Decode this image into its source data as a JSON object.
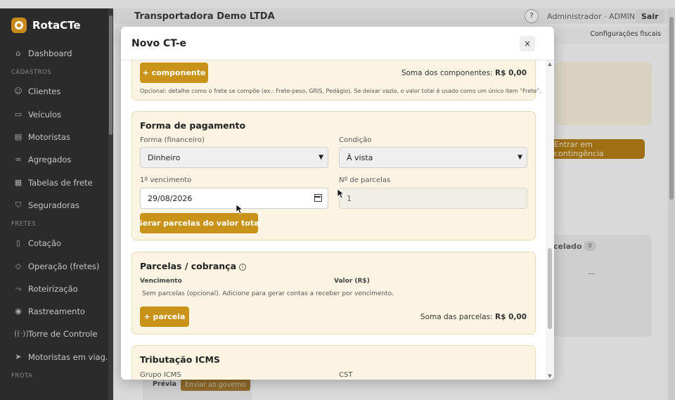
{
  "sidebar": {
    "brand": "RotaCTe",
    "dashboard": "Dashboard",
    "section_cadastros": "CADASTROS",
    "cadastros": [
      "Clientes",
      "Veículos",
      "Motoristas",
      "Agregados",
      "Tabelas de frete",
      "Seguradoras"
    ],
    "section_fretes": "FRETES",
    "fretes": [
      "Cotação",
      "Operação (fretes)",
      "Roteirização",
      "Rastreamento",
      "Torre de Controle",
      "Motoristas em viag..."
    ],
    "section_frota": "FROTA"
  },
  "topbar": {
    "company": "Transportadora Demo LTDA",
    "help": "?",
    "user": "Administrador · ADMIN",
    "logout": "Sair"
  },
  "background": {
    "fiscal_tab": "Configurações fiscais",
    "contingency_button": "Entrar em contingência",
    "cancelled_label": "celado",
    "cancelled_count": "0",
    "dash": "—",
    "preview_button": "Prévia",
    "send_button": "Enviar ao governo"
  },
  "modal": {
    "title": "Novo CT-e",
    "close": "×",
    "componentes": {
      "add_button": "+ componente",
      "sum_label": "Soma dos componentes:",
      "sum_value": "R$ 0,00",
      "hint": "Opcional: detalhe como o frete se compõe (ex.: Frete-peso, GRIS, Pedágio). Se deixar vazio, o valor total é usado como um único item \"Frete\"."
    },
    "pagamento": {
      "title": "Forma de pagamento",
      "forma_label": "Forma (financeiro)",
      "forma_value": "Dinheiro",
      "condicao_label": "Condição",
      "condicao_value": "À vista",
      "venc_label": "1º vencimento",
      "venc_value": "29/08/2026",
      "parcelas_label": "Nº de parcelas",
      "parcelas_value": "1",
      "gerar_button": "Gerar parcelas do valor total"
    },
    "parcelas": {
      "title": "Parcelas / cobrança",
      "col_vencimento": "Vencimento",
      "col_valor": "Valor (R$)",
      "empty": "Sem parcelas (opcional). Adicione para gerar contas a receber por vencimento.",
      "add_button": "+ parcela",
      "sum_label": "Soma das parcelas:",
      "sum_value": "R$ 0,00"
    },
    "icms": {
      "title": "Tributação ICMS",
      "grupo_label": "Grupo ICMS",
      "cst_label": "CST"
    }
  },
  "colors": {
    "accent": "#c9931a",
    "section_bg": "#fbf4e2",
    "sidebar_bg": "#2b2b2b"
  }
}
